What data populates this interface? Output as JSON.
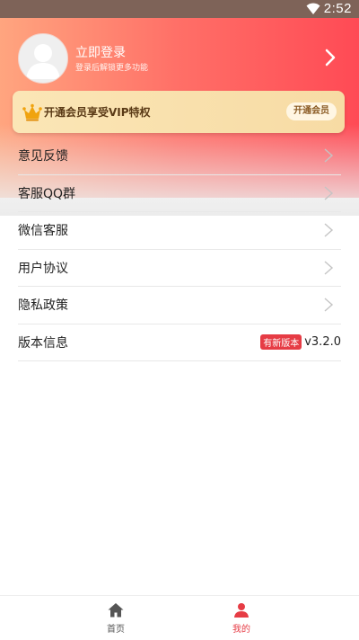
{
  "status_bar": {
    "time": "2:52"
  },
  "profile": {
    "login_title": "立即登录",
    "login_subtitle": "登录后解锁更多功能"
  },
  "vip": {
    "text": "开通会员享受VIP特权",
    "button_label": "开通会员"
  },
  "menu": [
    {
      "label": "意见反馈"
    },
    {
      "label": "客服QQ群"
    },
    {
      "label": "微信客服"
    },
    {
      "label": "用户协议"
    },
    {
      "label": "隐私政策"
    }
  ],
  "version_row": {
    "label": "版本信息",
    "badge": "有新版本",
    "version": "v3.2.0"
  },
  "bottom_nav": {
    "items": [
      {
        "label": "首页",
        "icon": "home-icon",
        "color": "#555555"
      },
      {
        "label": "我的",
        "icon": "person-icon",
        "color": "#e63c45"
      }
    ]
  },
  "colors": {
    "accent": "#e63c45",
    "header_start": "#ffa57f",
    "header_end": "#ff4a55",
    "vip_bg": "#f7dba4"
  }
}
